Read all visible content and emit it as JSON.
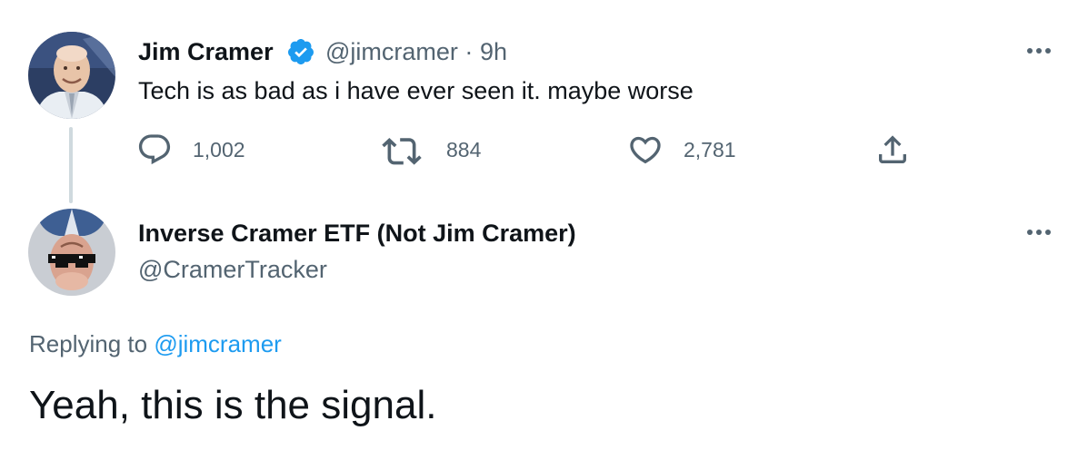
{
  "original_tweet": {
    "author_name": "Jim Cramer",
    "handle": "@jimcramer",
    "separator": "·",
    "time": "9h",
    "text": "Tech is as bad as i have ever seen it. maybe worse",
    "verified": true,
    "actions": {
      "reply": {
        "icon": "reply-icon",
        "count": "1,002"
      },
      "retweet": {
        "icon": "retweet-icon",
        "count": "884"
      },
      "like": {
        "icon": "heart-icon",
        "count": "2,781"
      },
      "share": {
        "icon": "share-icon"
      }
    }
  },
  "reply_tweet": {
    "author_name": "Inverse Cramer ETF (Not Jim Cramer)",
    "handle": "@CramerTracker",
    "replying_prefix": "Replying to",
    "replying_to": "@jimcramer",
    "text": "Yeah, this is the signal."
  },
  "colors": {
    "primary_text": "#0f1419",
    "secondary_text": "#536471",
    "accent_blue": "#1d9bf0",
    "thread_line": "#cfd9de"
  }
}
